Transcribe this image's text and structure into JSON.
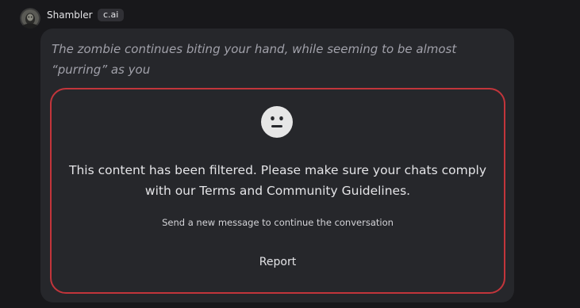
{
  "author": {
    "name": "Shambler",
    "badge": "c.ai",
    "avatar_icon": "zombie-avatar-icon"
  },
  "message": {
    "text": "The zombie continues biting your hand, while seeming to be almost “purring” as you"
  },
  "filter": {
    "icon": "neutral-face-icon",
    "title": "This content has been filtered. Please make sure your chats comply with our Terms and Community Guidelines.",
    "subtitle": "Send a new message to continue the conversation",
    "report_label": "Report",
    "border_color": "#c2353b"
  },
  "colors": {
    "background": "#18181b",
    "bubble": "#26272b",
    "badge_bg": "#303035",
    "message_text": "#a1a1aa"
  }
}
